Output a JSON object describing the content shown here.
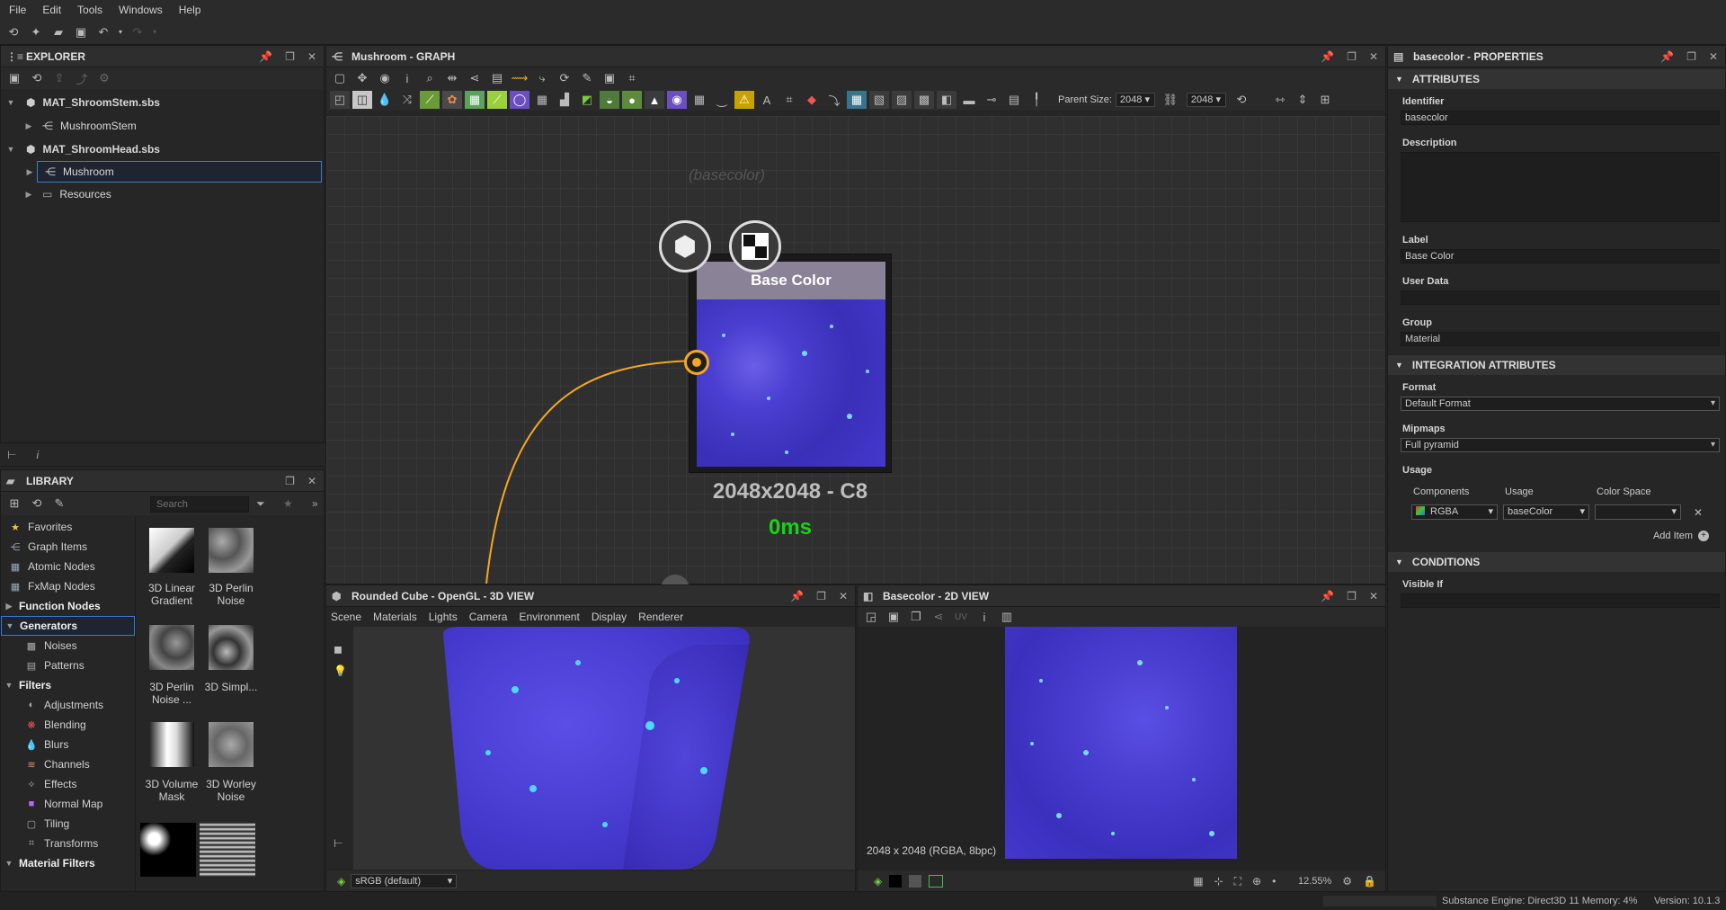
{
  "menu": [
    "File",
    "Edit",
    "Tools",
    "Windows",
    "Help"
  ],
  "explorer": {
    "title": "EXPLORER",
    "items": [
      {
        "label": "MAT_ShroomStem.sbs"
      },
      {
        "label": "MushroomStem"
      },
      {
        "label": "MAT_ShroomHead.sbs"
      },
      {
        "label": "Mushroom"
      },
      {
        "label": "Resources"
      }
    ]
  },
  "library": {
    "title": "LIBRARY",
    "search_placeholder": "Search",
    "categories": [
      {
        "label": "Favorites"
      },
      {
        "label": "Graph Items"
      },
      {
        "label": "Atomic Nodes"
      },
      {
        "label": "FxMap Nodes"
      },
      {
        "label": "Function Nodes"
      },
      {
        "label": "Generators"
      },
      {
        "label": "Noises"
      },
      {
        "label": "Patterns"
      },
      {
        "label": "Filters"
      },
      {
        "label": "Adjustments"
      },
      {
        "label": "Blending"
      },
      {
        "label": "Blurs"
      },
      {
        "label": "Channels"
      },
      {
        "label": "Effects"
      },
      {
        "label": "Normal Map"
      },
      {
        "label": "Tiling"
      },
      {
        "label": "Transforms"
      },
      {
        "label": "Material Filters"
      }
    ],
    "items": [
      {
        "label": "3D Linear Gradient"
      },
      {
        "label": "3D Perlin Noise"
      },
      {
        "label": "3D Perlin Noise ..."
      },
      {
        "label": "3D Simpl..."
      },
      {
        "label": "3D Volume Mask"
      },
      {
        "label": "3D Worley Noise"
      }
    ]
  },
  "graph": {
    "title": "Mushroom - GRAPH",
    "parent_size_label": "Parent Size:",
    "parent_size": "2048",
    "size2": "2048",
    "node": {
      "title": "Base Color",
      "ghost": "(basecolor)",
      "resolution": "2048x2048 - C8",
      "time": "0ms"
    }
  },
  "view3d": {
    "title": "Rounded Cube - OpenGL - 3D VIEW",
    "menu": [
      "Scene",
      "Materials",
      "Lights",
      "Camera",
      "Environment",
      "Display",
      "Renderer"
    ],
    "colorspace": "sRGB (default)"
  },
  "view2d": {
    "title": "Basecolor - 2D VIEW",
    "uv_label": "UV",
    "info": "2048 x 2048 (RGBA, 8bpc)",
    "zoom": "12.55%"
  },
  "properties": {
    "title": "basecolor - PROPERTIES",
    "attributes_header": "ATTRIBUTES",
    "identifier_label": "Identifier",
    "identifier": "basecolor",
    "description_label": "Description",
    "label_label": "Label",
    "label": "Base Color",
    "userdata_label": "User Data",
    "group_label": "Group",
    "group": "Material",
    "integration_header": "INTEGRATION ATTRIBUTES",
    "format_label": "Format",
    "format": "Default Format",
    "mipmaps_label": "Mipmaps",
    "mipmaps": "Full pyramid",
    "usage_label": "Usage",
    "col_components": "Components",
    "col_usage": "Usage",
    "col_colorspace": "Color Space",
    "components": "RGBA",
    "usage": "baseColor",
    "colorspace": "",
    "add_item": "Add Item",
    "conditions_header": "CONDITIONS",
    "visible_if_label": "Visible If"
  },
  "status": {
    "engine": "Substance Engine: Direct3D 11  Memory: 4%",
    "version": "Version: 10.1.3"
  },
  "colors": {
    "accent": "#f5a623",
    "selection": "#3a7bd5",
    "texture": "#4a3fd0",
    "time": "#19d219"
  }
}
